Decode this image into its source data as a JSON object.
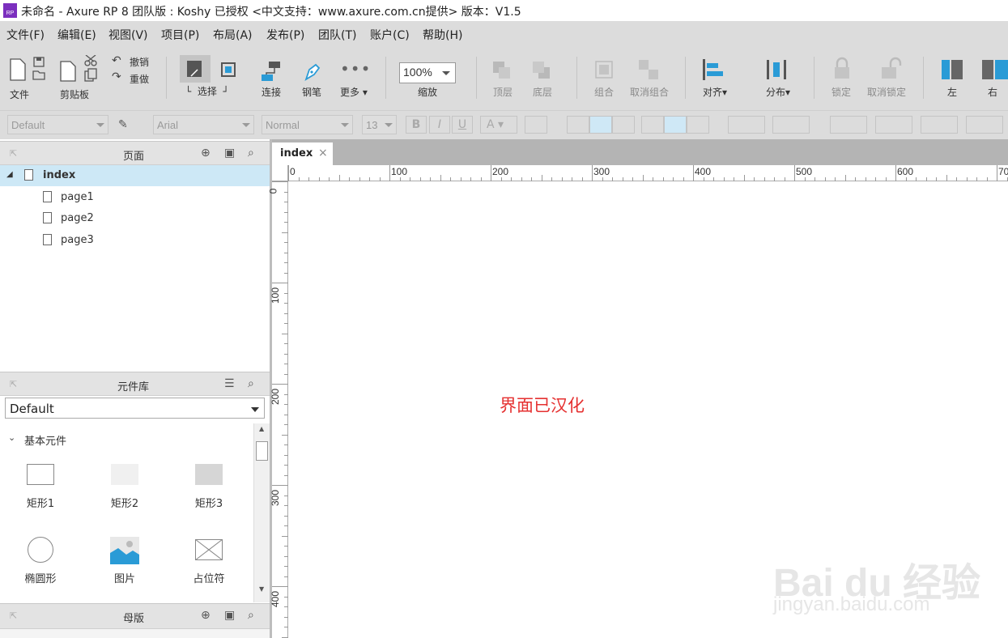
{
  "window": {
    "title": "未命名 - Axure RP 8 团队版 : Koshy  已授权     <中文支持：www.axure.com.cn提供> 版本：V1.5",
    "logo_text": "RP"
  },
  "menu": [
    "文件(F)",
    "编辑(E)",
    "视图(V)",
    "项目(P)",
    "布局(A)",
    "发布(P)",
    "团队(T)",
    "账户(C)",
    "帮助(H)"
  ],
  "toolbar": {
    "file": "文件",
    "clipboard": "剪贴板",
    "undo": "撤销",
    "redo": "重做",
    "select": "选择",
    "connect": "连接",
    "pen": "钢笔",
    "more": "更多",
    "zoom_value": "100%",
    "zoom": "缩放",
    "top": "顶层",
    "bottom": "底层",
    "group": "组合",
    "ungroup": "取消组合",
    "align": "对齐",
    "distribute": "分布",
    "lock": "锁定",
    "unlock": "取消锁定",
    "left": "左",
    "right": "右"
  },
  "format": {
    "style": "Default",
    "font": "Arial",
    "weight": "Normal",
    "size": "13",
    "bold": "B",
    "italic": "I",
    "underline": "U",
    "font_color": "A"
  },
  "pages_panel": {
    "title": "页面",
    "pages": [
      {
        "name": "index"
      },
      {
        "name": "page1"
      },
      {
        "name": "page2"
      },
      {
        "name": "page3"
      }
    ]
  },
  "library_panel": {
    "title": "元件库",
    "selected_library": "Default",
    "section": "基本元件",
    "widgets": [
      "矩形1",
      "矩形2",
      "矩形3",
      "椭圆形",
      "图片",
      "占位符"
    ]
  },
  "masters_panel": {
    "title": "母版"
  },
  "tab": {
    "label": "index",
    "close": "×"
  },
  "ruler": {
    "h_ticks": [
      "0",
      "100",
      "200",
      "300",
      "400",
      "500",
      "600",
      "70"
    ],
    "v_ticks": [
      "0",
      "100",
      "200",
      "300",
      "400"
    ]
  },
  "canvas": {
    "text": "界面已汉化",
    "text_color": "#e53030"
  },
  "watermark": {
    "logo": "Bai du 经验",
    "url": "jingyan.baidu.com"
  },
  "colors": {
    "accent": "#2a9bd6",
    "selection": "#cde8f6",
    "chrome": "#dcdcdc"
  }
}
